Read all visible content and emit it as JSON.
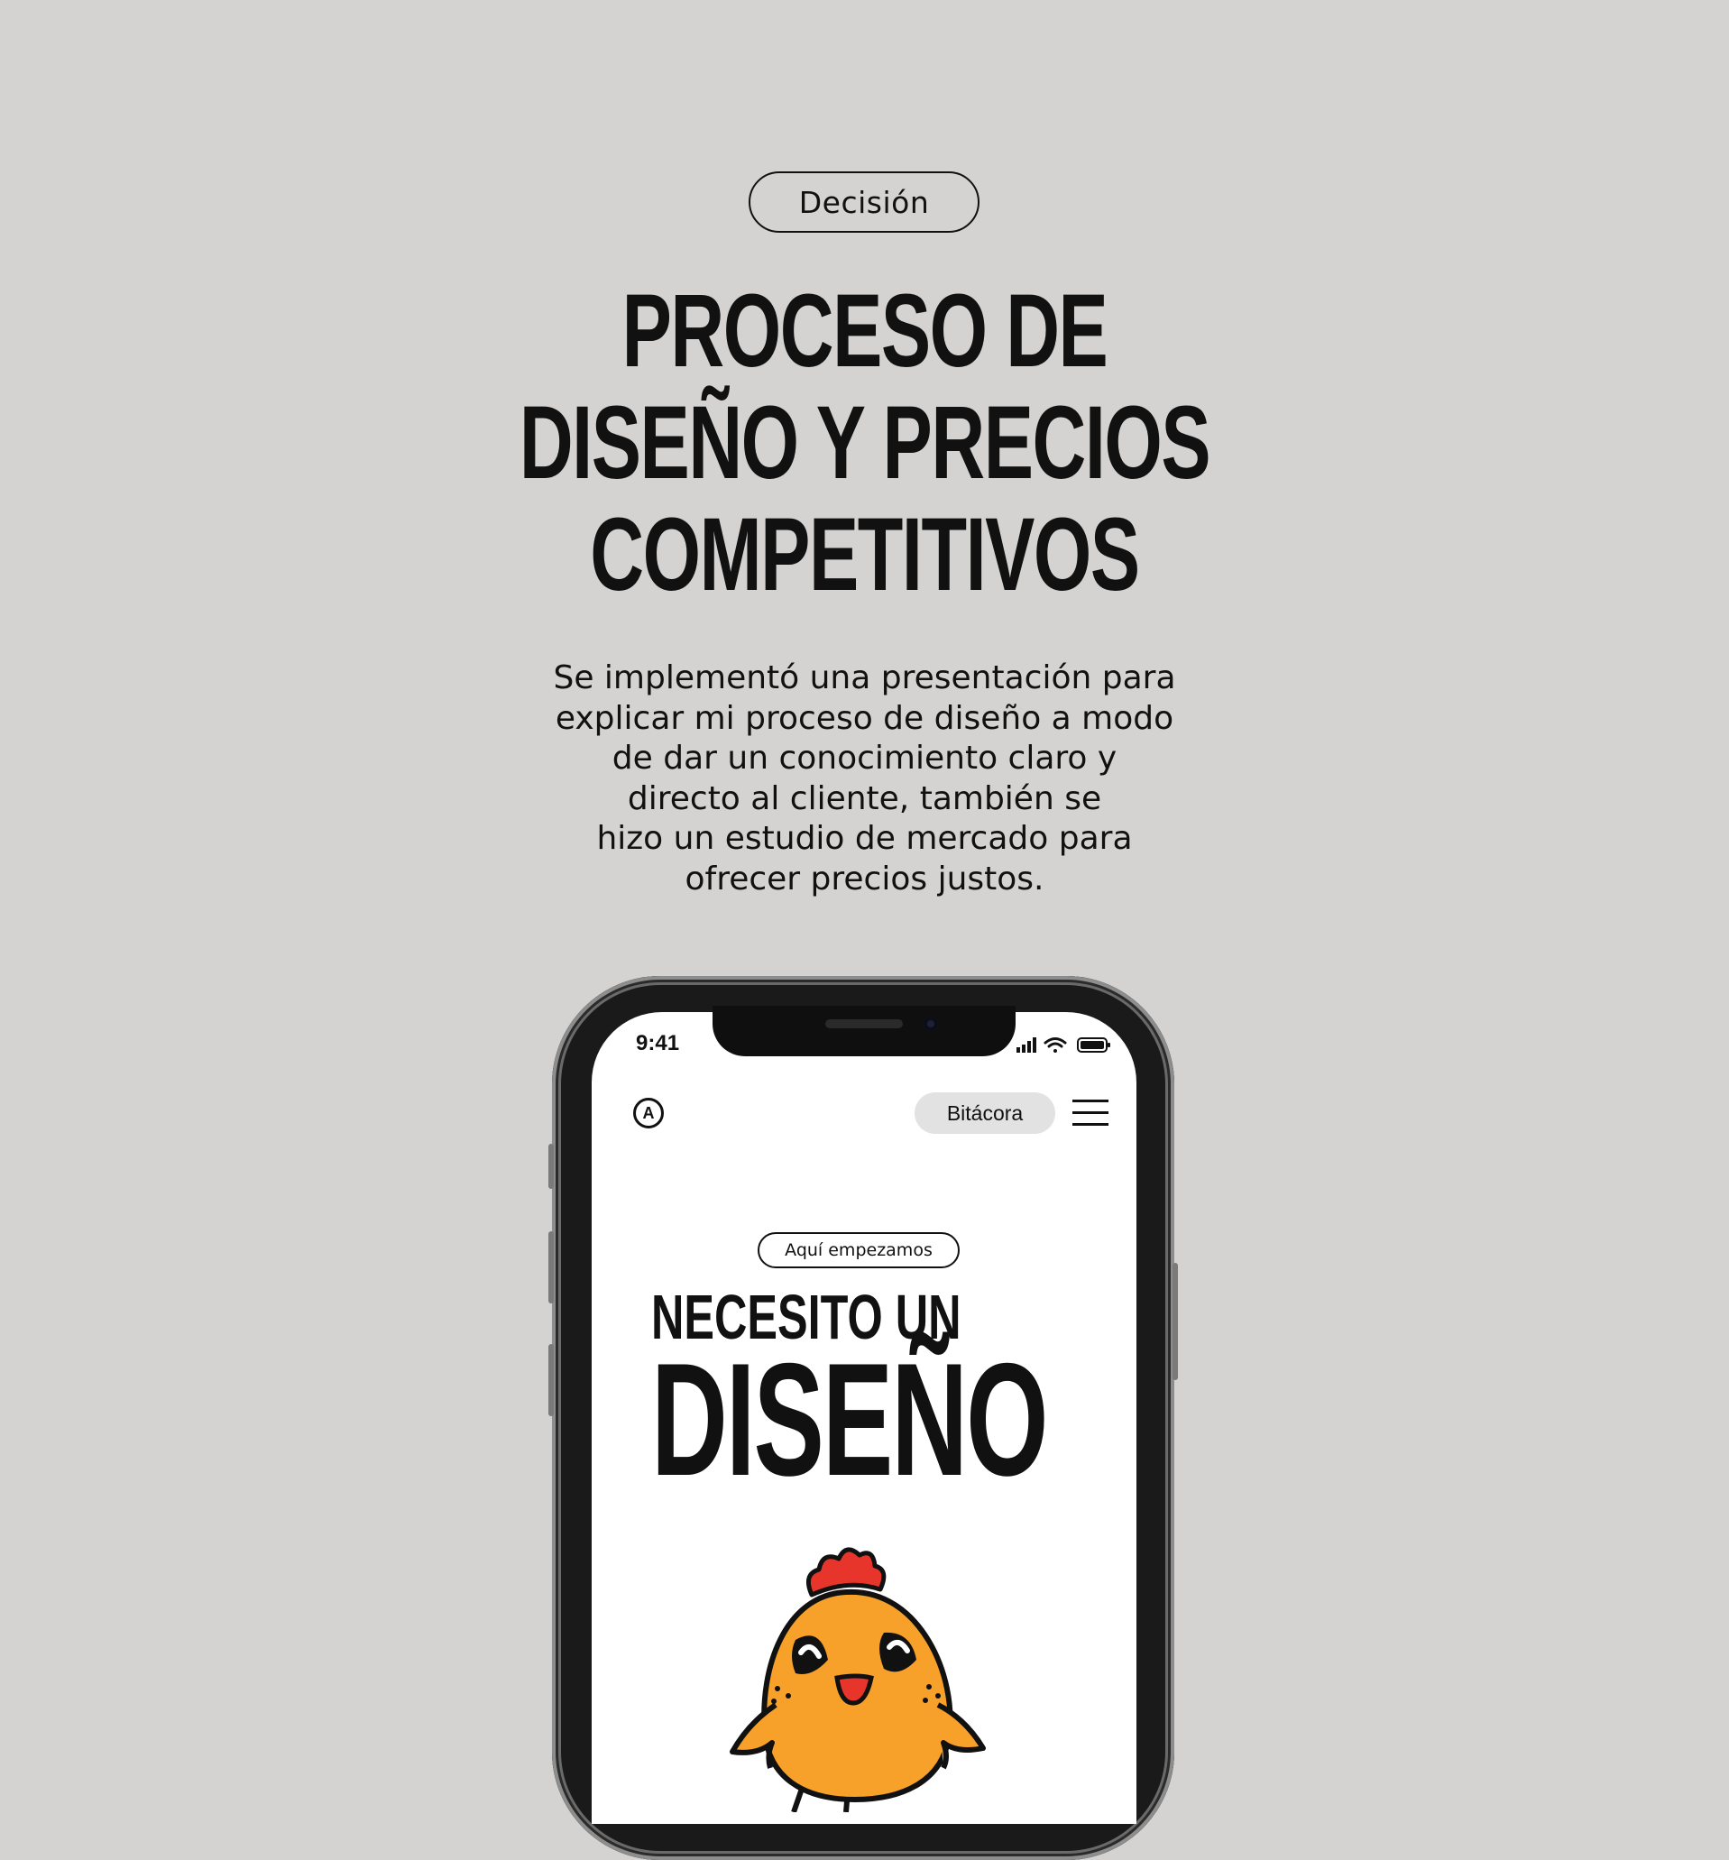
{
  "badge": "Decisión",
  "headline": [
    "PROCESO DE",
    "DISEÑO Y PRECIOS",
    "COMPETITIVOS"
  ],
  "description": [
    "Se implementó una presentación para",
    "explicar mi proceso de diseño a modo",
    "de dar un conocimiento claro y",
    "directo al cliente, también se",
    "hizo un estudio de mercado para",
    "ofrecer precios justos."
  ],
  "phone": {
    "status_time": "9:41",
    "logo_letter": "A",
    "nav_button": "Bitácora",
    "menu_icon": "hamburger-menu-icon",
    "tag": "Aquí empezamos",
    "hero_line1": "NECESITO UN",
    "hero_line2": "DISEÑO",
    "mascot": "chick-mascot"
  },
  "colors": {
    "background": "#d4d3d1",
    "mascot_body": "#f7a12a",
    "mascot_comb": "#e8352b"
  }
}
